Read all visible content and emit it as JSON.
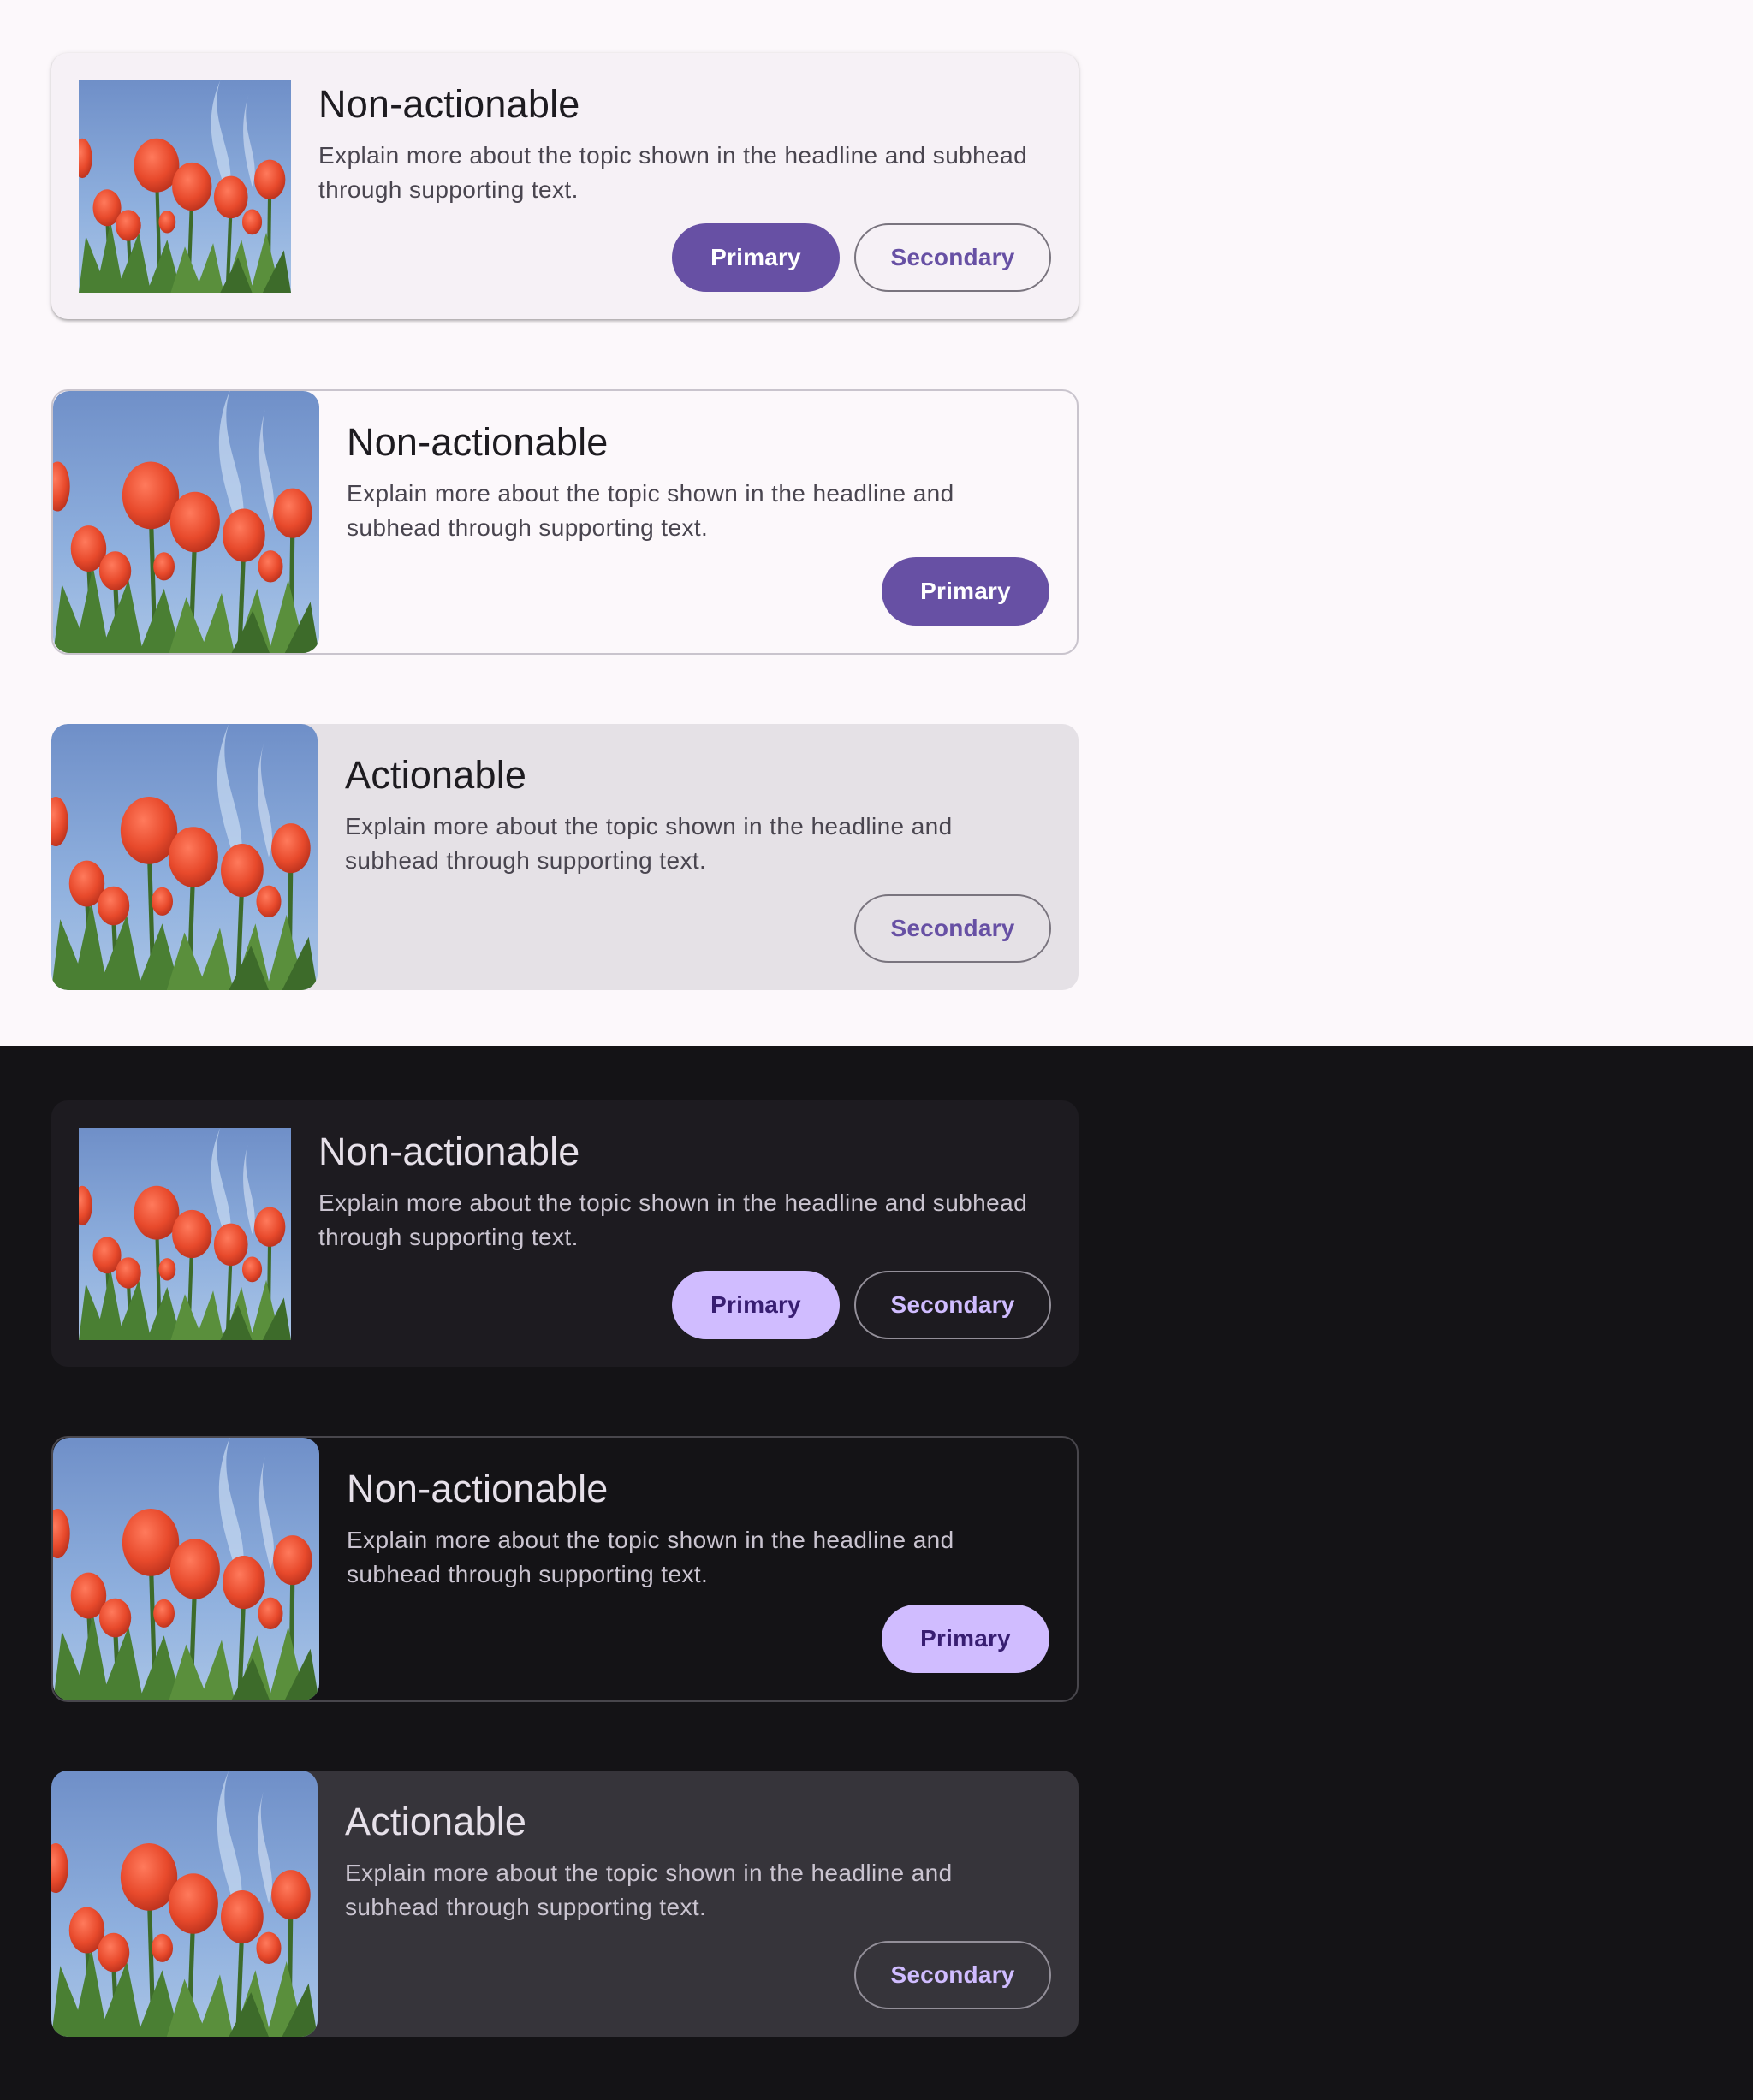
{
  "themes": {
    "light": {
      "cards": [
        {
          "headline": "Non-actionable",
          "support": "Explain more about the topic shown in the headline and subhead through supporting text.",
          "primary_label": "Primary",
          "secondary_label": "Secondary"
        },
        {
          "headline": "Non-actionable",
          "support": "Explain more about the topic shown in the headline and subhead through supporting text.",
          "primary_label": "Primary"
        },
        {
          "headline": "Actionable",
          "support": "Explain more about the topic shown in the headline and subhead through supporting text.",
          "secondary_label": "Secondary"
        }
      ]
    },
    "dark": {
      "cards": [
        {
          "headline": "Non-actionable",
          "support": "Explain more about the topic shown in the headline and subhead through supporting text.",
          "primary_label": "Primary",
          "secondary_label": "Secondary"
        },
        {
          "headline": "Non-actionable",
          "support": "Explain more about the topic shown in the headline and subhead through supporting text.",
          "primary_label": "Primary"
        },
        {
          "headline": "Actionable",
          "support": "Explain more about the topic shown in the headline and subhead through supporting text.",
          "secondary_label": "Secondary"
        }
      ]
    }
  },
  "colors": {
    "light_background": "#fcf8fb",
    "dark_background": "#141316",
    "light_primary": "#6750a4",
    "dark_primary": "#d0bcff"
  },
  "media": {
    "icon": "tulip-photo"
  }
}
